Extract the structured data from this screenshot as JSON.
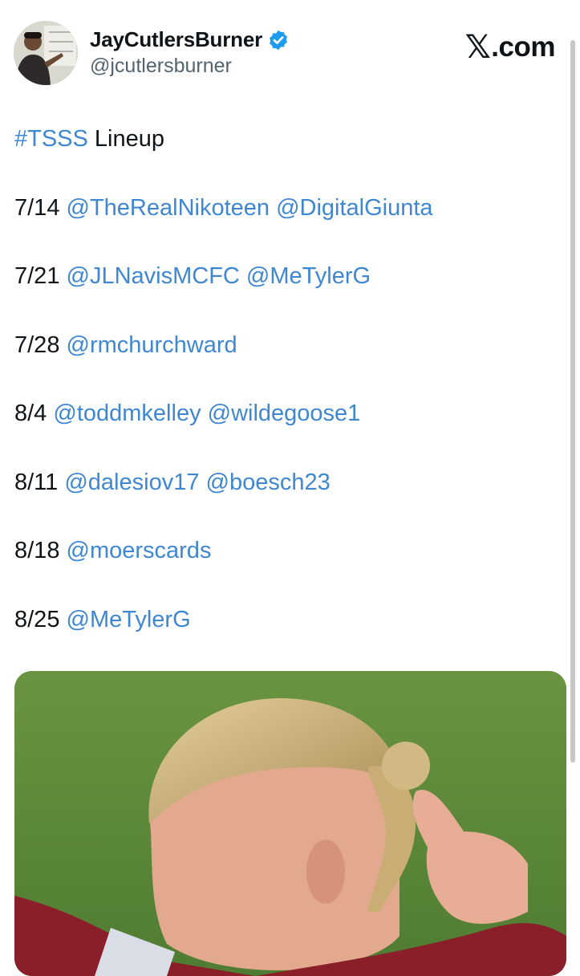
{
  "author": {
    "display_name": "JayCutlersBurner",
    "handle": "@jcutlersburner"
  },
  "site": {
    "brand_text": ".com",
    "brand_glyph": "𝕏"
  },
  "tweet": {
    "hashtag": "#TSSS",
    "title_rest": " Lineup",
    "lineup": [
      {
        "date": "7/14",
        "mentions": [
          "@TheRealNikoteen",
          "@DigitalGiunta"
        ]
      },
      {
        "date": "7/21",
        "mentions": [
          "@JLNavisMCFC",
          "@MeTylerG"
        ]
      },
      {
        "date": "7/28",
        "mentions": [
          "@rmchurchward"
        ]
      },
      {
        "date": "8/4",
        "mentions": [
          "@toddmkelley",
          "@wildegoose1"
        ]
      },
      {
        "date": "8/11",
        "mentions": [
          "@dalesiov17",
          "@boesch23"
        ]
      },
      {
        "date": "8/18",
        "mentions": [
          "@moerscards"
        ]
      },
      {
        "date": "8/25",
        "mentions": [
          "@MeTylerG"
        ]
      }
    ]
  },
  "colors": {
    "link": "#3f87d1",
    "verified": "#1d9bf0",
    "handle": "#536471",
    "pitch": "#5e8a3b"
  }
}
